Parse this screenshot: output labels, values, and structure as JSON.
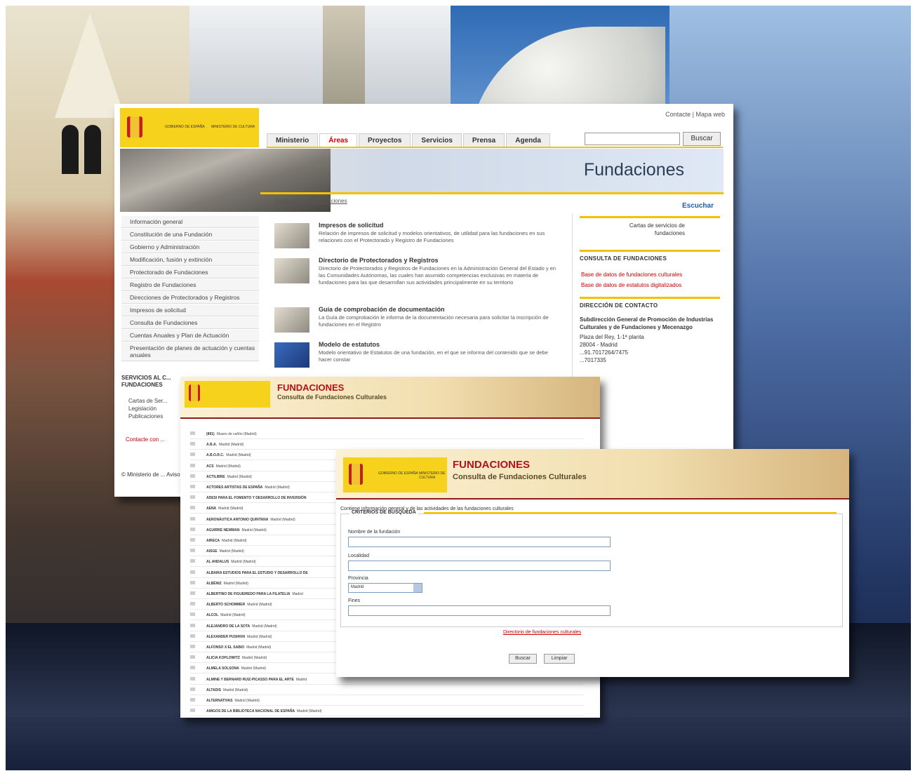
{
  "portal": {
    "top_links": "Contacte | Mapa web",
    "tabs": [
      "Ministerio",
      "Áreas",
      "Proyectos",
      "Servicios",
      "Prensa",
      "Agenda"
    ],
    "search_button": "Buscar",
    "title": "Fundaciones",
    "breadcrumb": "Inicio > Áreas > Fundaciones",
    "listen": "Escuchar",
    "side_menu": [
      "Información general",
      "Constitución de una Fundación",
      "Gobierno y Administración",
      "Modificación, fusión y extinción",
      "Protectorado de Fundaciones",
      "Registro de Fundaciones",
      "Direcciones de Protectorados y Registros",
      "Impresos de solicitud",
      "Consulta de Fundaciones",
      "Cuentas Anuales y Plan de Actuación",
      "Presentación de planes de actuación y cuentas anuales"
    ],
    "services_heading": "SERVICIOS AL C... FUNDACIONES",
    "services_list": [
      "Cartas de Ser...",
      "Legislación",
      "Publicaciones"
    ],
    "contact_link": "Contacte con ...",
    "copyright": "© Ministerio de ... Aviso Legal | Gu...",
    "items": [
      {
        "title": "Impresos de solicitud",
        "text": "Relación de impresos de solicitud y modelos orientativos, de utilidad para las fundaciones en sus relaciones con el Protectorado y Registro de Fundaciones"
      },
      {
        "title": "Directorio de Protectorados y Registros",
        "text": "Directorio de Protectorados y Registros de Fundaciones en la Administración General del Estado y en las Comunidades Autónomas, las cuales han asumido competencias exclusivas en materia de fundaciones para las que desarrollan sus actividades principalmente en su territorio"
      },
      {
        "title": "Guía de comprobación de documentación",
        "text": "La Guía de comprobación le informa de la documentación necesaria para solicitar la inscripción de fundaciones en el Registro"
      },
      {
        "title": "Modelo de estatutos",
        "text": "Modelo orientativo de Estatutos de una fundación, en el que se informa del contenido que se debe hacer constar"
      }
    ],
    "right": {
      "cartas": "Cartas de servicios de fundaciones",
      "consulta_heading": "CONSULTA DE FUNDACIONES",
      "links": [
        "Base de datos de fundaciones culturales",
        "Base de datos de estatutos digitalizados"
      ],
      "contact_heading": "DIRECCIÓN DE CONTACTO",
      "contact_org": "Subdirección General de Promoción de Industrias Culturales y de Fundaciones y Mecenazgo",
      "contact_addr": "Plaza del Rey, 1-1ª planta",
      "contact_city": "28004 - Madrid",
      "contact_tel": "...91.7017264/7475",
      "contact_fax": "...7017335"
    }
  },
  "list_panel": {
    "title": "FUNDACIONES",
    "subtitle": "Consulta de Fundaciones Culturales",
    "rows": [
      {
        "name": "(891)",
        "place": "Museo de cañón (Madrid)"
      },
      {
        "name": "A.B.A.",
        "place": "Madrid (Madrid)"
      },
      {
        "name": "A.B.O.R.C.",
        "place": "Madrid (Madrid)"
      },
      {
        "name": "ACS",
        "place": "Madrid (Madrid)"
      },
      {
        "name": "ACTILIBRE",
        "place": "Madrid (Madrid)"
      },
      {
        "name": "ACTORES ARTISTAS DE ESPAÑA",
        "place": "Madrid (Madrid)"
      },
      {
        "name": "ADESI PARA EL FOMENTO Y DESARROLLO DE INVERSIÓN",
        "place": ""
      },
      {
        "name": "AENA",
        "place": "Madrid (Madrid)"
      },
      {
        "name": "AERONÁUTICA ANTONIO QUINTANA",
        "place": "Madrid (Madrid)"
      },
      {
        "name": "AGUIRRE NEWMAN",
        "place": "Madrid (Madrid)"
      },
      {
        "name": "AIRECA",
        "place": "Madrid (Madrid)"
      },
      {
        "name": "AISGE",
        "place": "Madrid (Madrid)"
      },
      {
        "name": "AL ANDALUS",
        "place": "Madrid (Madrid)"
      },
      {
        "name": "ALBAIRA ESTUDIOS PARA EL ESTUDIO Y DESARROLLO DE",
        "place": ""
      },
      {
        "name": "ALBÉNIZ",
        "place": "Madrid (Madrid)"
      },
      {
        "name": "ALBERTINO DE FIGUEIREDO PARA LA FILATELIA",
        "place": "Madrid"
      },
      {
        "name": "ALBERTO SCHOMMER",
        "place": "Madrid (Madrid)"
      },
      {
        "name": "ALCOL",
        "place": "Madrid (Madrid)"
      },
      {
        "name": "ALEJANDRO DE LA SOTA",
        "place": "Madrid (Madrid)"
      },
      {
        "name": "ALEXANDER PUSHKIN",
        "place": "Madrid (Madrid)"
      },
      {
        "name": "ALFONSO X EL SABIO",
        "place": "Madrid (Madrid)"
      },
      {
        "name": "ALICIA KOPLOWITZ",
        "place": "Madrid (Madrid)"
      },
      {
        "name": "ALMELA SOLSONA",
        "place": "Madrid (Madrid)"
      },
      {
        "name": "ALMINE Y BERNARD RUIZ-PICASSO PARA EL ARTE",
        "place": "Madrid"
      },
      {
        "name": "ALTADIS",
        "place": "Madrid (Madrid)"
      },
      {
        "name": "ALTERNATIVAS",
        "place": "Madrid (Madrid)"
      },
      {
        "name": "AMIGOS DE LA BIBLIOTECA NACIONAL DE ESPAÑA",
        "place": "Madrid (Madrid)"
      }
    ]
  },
  "search_panel": {
    "title": "FUNDACIONES",
    "subtitle": "Consulta de Fundaciones Culturales",
    "intro": "Contiene información general y de las actividades de las fundaciones culturales",
    "legend": "CRITERIOS DE BUSQUEDA",
    "label_name": "Nombre de la fundación",
    "label_locality": "Localidad",
    "label_province": "Provincia",
    "province_value": "Madrid",
    "label_purposes": "Fines",
    "directory_link": "Directorio de fundaciones culturales",
    "search_button": "Buscar",
    "clear_button": "Limpiar"
  },
  "logo": {
    "line1": "GOBIERNO DE ESPAÑA",
    "line2": "MINISTERIO DE CULTURA"
  },
  "colors": {
    "accent_yellow": "#f2c200",
    "brand_red": "#b1121b",
    "link_red": "#cc0000"
  }
}
